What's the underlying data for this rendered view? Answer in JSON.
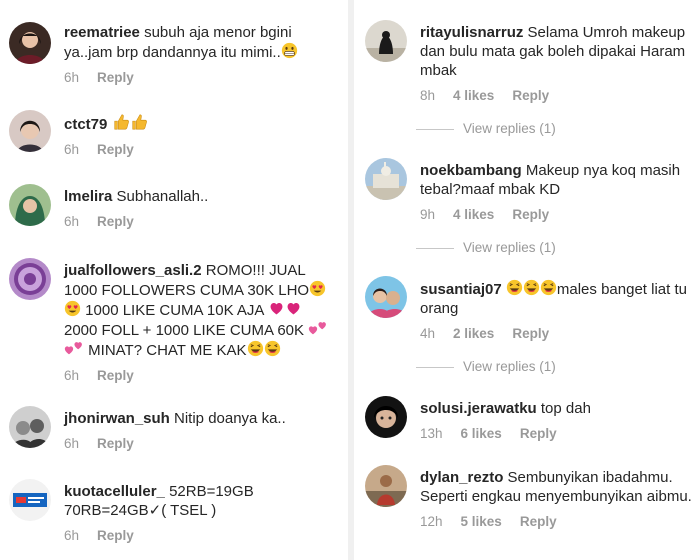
{
  "left": [
    {
      "user": "reematriee",
      "msg": "subuh aja menor bgini ya..jam brp dandannya itu mimi..",
      "emoji": "grin-icon",
      "time": "6h",
      "reply": "Reply"
    },
    {
      "user": "ctct79",
      "msg": "",
      "emoji": "thumbs-up-icon",
      "time": "6h",
      "reply": "Reply"
    },
    {
      "user": "lmelira",
      "msg": "Subhanallah..",
      "time": "6h",
      "reply": "Reply"
    },
    {
      "user": "jualfollowers_asli.2",
      "msg_parts": [
        "ROMO!!! JUAL 1000 FOLLOWERS CUMA 30K LHO",
        "1000 LIKE CUMA 10K AJA",
        "2000 FOLL + 1000 LIKE CUMA 60K",
        "MINAT? CHAT ME KAK"
      ],
      "time": "6h",
      "reply": "Reply"
    },
    {
      "user": "jhonirwan_suh",
      "msg": "Nitip doanya ka..",
      "time": "6h",
      "reply": "Reply"
    },
    {
      "user": "kuotacelluler_",
      "msg": "52RB=19GB 70RB=24GB✓( TSEL )",
      "time": "6h",
      "reply": "Reply"
    }
  ],
  "right": [
    {
      "user": "ritayulisnarruz",
      "msg": "Selama Umroh makeup dan bulu mata gak boleh dipakai Haram mbak",
      "time": "8h",
      "likes": "4 likes",
      "reply": "Reply",
      "view_replies": "View replies (1)"
    },
    {
      "user": "noekbambang",
      "msg": "Makeup nya koq masih tebal?maaf mbak KD",
      "time": "9h",
      "likes": "4 likes",
      "reply": "Reply",
      "view_replies": "View replies (1)"
    },
    {
      "user": "susantiaj07",
      "msg": "males banget liat tu orang",
      "time": "4h",
      "likes": "2 likes",
      "reply": "Reply",
      "view_replies": "View replies (1)"
    },
    {
      "user": "solusi.jerawatku",
      "msg": "top dah",
      "time": "13h",
      "likes": "6 likes",
      "reply": "Reply"
    },
    {
      "user": "dylan_rezto",
      "msg": "Sembunyikan ibadahmu. Seperti engkau menyembunyikan aibmu.",
      "time": "12h",
      "likes": "5 likes",
      "reply": "Reply"
    }
  ],
  "colors": {
    "text": "#262626",
    "muted": "#999999",
    "emoji": "#f5c518",
    "heart": "#d9247a"
  }
}
